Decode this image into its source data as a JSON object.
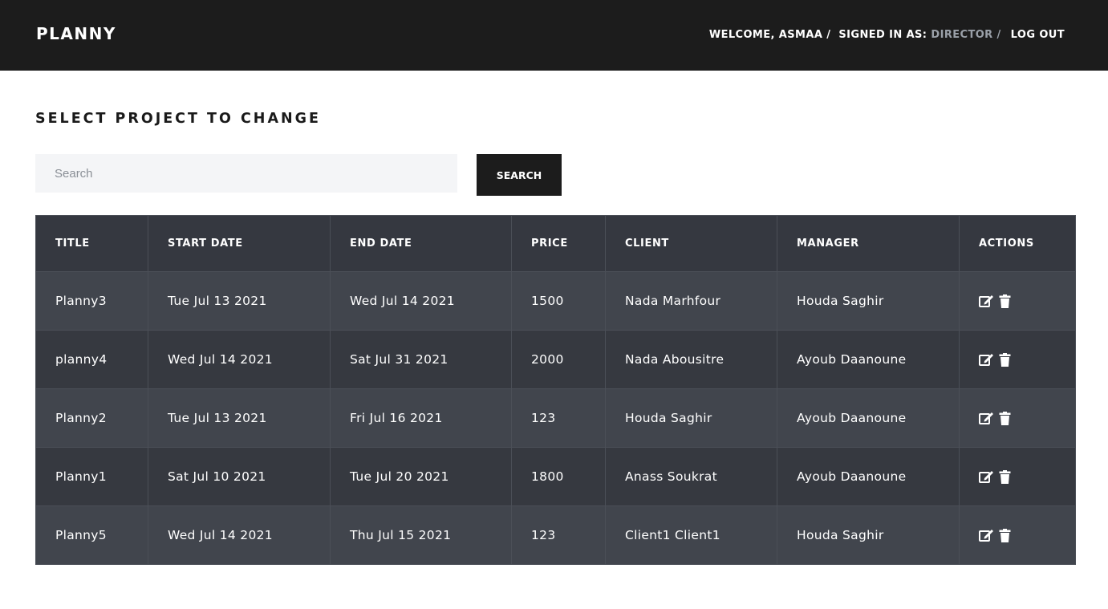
{
  "header": {
    "logo": "PLANNY",
    "welcome": "WELCOME, ASMAA /",
    "signed_in_label": "SIGNED IN AS:",
    "role": "DIRECTOR /",
    "logout": "LOG OUT"
  },
  "page": {
    "title": "SELECT PROJECT TO CHANGE"
  },
  "search": {
    "placeholder": "Search",
    "value": "",
    "button_label": "SEARCH"
  },
  "table": {
    "columns": [
      "TITLE",
      "START DATE",
      "END DATE",
      "PRICE",
      "CLIENT",
      "MANAGER",
      "ACTIONS"
    ],
    "rows": [
      [
        "Planny3",
        "Tue Jul 13 2021",
        "Wed Jul 14 2021",
        "1500",
        "Nada Marhfour",
        "Houda Saghir"
      ],
      [
        "planny4",
        "Wed Jul 14 2021",
        "Sat Jul 31 2021",
        "2000",
        "Nada Abousitre",
        "Ayoub Daanoune"
      ],
      [
        "Planny2",
        "Tue Jul 13 2021",
        "Fri Jul 16 2021",
        "123",
        "Houda Saghir",
        "Ayoub Daanoune"
      ],
      [
        "Planny1",
        "Sat Jul 10 2021",
        "Tue Jul 20 2021",
        "1800",
        "Anass Soukrat",
        "Ayoub Daanoune"
      ],
      [
        "Planny5",
        "Wed Jul 14 2021",
        "Thu Jul 15 2021",
        "123",
        "Client1 Client1",
        "Houda Saghir"
      ]
    ],
    "row_actions": [
      "edit-icon",
      "trash-icon"
    ]
  },
  "colors": {
    "topbar": "#1c1c1c",
    "header_row": "#353840",
    "row_odd": "#41454d",
    "row_even": "#363940",
    "muted_text": "#9aa0a8"
  }
}
